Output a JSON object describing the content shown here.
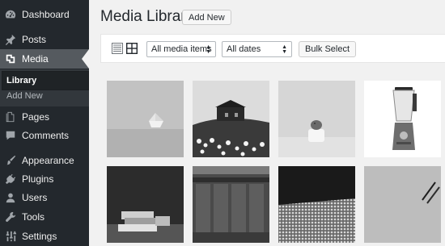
{
  "sidebar": {
    "items": [
      {
        "label": "Dashboard",
        "icon": "dashboard-icon"
      },
      {
        "label": "Posts",
        "icon": "pin-icon"
      },
      {
        "label": "Media",
        "icon": "media-icon"
      },
      {
        "label": "Pages",
        "icon": "pages-icon"
      },
      {
        "label": "Comments",
        "icon": "comment-icon"
      },
      {
        "label": "Appearance",
        "icon": "brush-icon"
      },
      {
        "label": "Plugins",
        "icon": "plugin-icon"
      },
      {
        "label": "Users",
        "icon": "user-icon"
      },
      {
        "label": "Tools",
        "icon": "wrench-icon"
      },
      {
        "label": "Settings",
        "icon": "settings-icon"
      }
    ],
    "submenu": {
      "library": "Library",
      "add_new": "Add New"
    }
  },
  "header": {
    "title": "Media Library",
    "add_new": "Add New"
  },
  "toolbar": {
    "filter_type": "All media items",
    "filter_date": "All dates",
    "bulk_select": "Bulk Select"
  },
  "colors": {
    "sidebar_bg": "#23282d",
    "sidebar_current": "#555a5f",
    "page_bg": "#f1f1f1"
  }
}
